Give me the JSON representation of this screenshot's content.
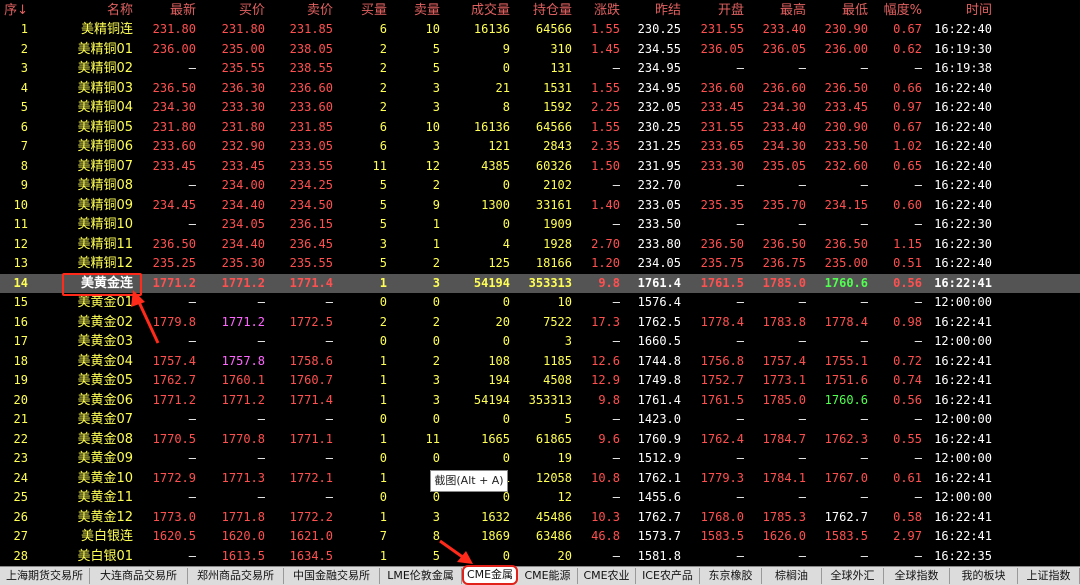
{
  "colors": {
    "header": "#e06060",
    "index": "#ffff55",
    "name": "#ffff55",
    "up": "#ff5050",
    "flat": "#ffffff",
    "down": "#50ff50",
    "volume": "#ffff55",
    "buy_purple": "#ff66ff",
    "highlight": "#ff2a1a"
  },
  "table": {
    "columns": [
      "序↓",
      "名称",
      "最新",
      "买价",
      "卖价",
      "买量",
      "卖量",
      "成交量",
      "持仓量",
      "涨跌",
      "昨结",
      "开盘",
      "最高",
      "最低",
      "幅度%",
      "时间"
    ],
    "rows": [
      [
        "1",
        "美精铜连",
        "231.80",
        "231.80",
        "231.85",
        "6",
        "10",
        "16136",
        "64566",
        "1.55",
        "230.25",
        "231.55",
        "233.40",
        "230.90",
        "0.67",
        "16:22:40"
      ],
      [
        "2",
        "美精铜01",
        "236.00",
        "235.00",
        "238.05",
        "2",
        "5",
        "9",
        "310",
        "1.45",
        "234.55",
        "236.05",
        "236.05",
        "236.00",
        "0.62",
        "16:19:30"
      ],
      [
        "3",
        "美精铜02",
        "—",
        "235.55",
        "238.55",
        "2",
        "5",
        "0",
        "131",
        "—",
        "234.95",
        "—",
        "—",
        "—",
        "—",
        "16:19:38"
      ],
      [
        "4",
        "美精铜03",
        "236.50",
        "236.30",
        "236.60",
        "2",
        "3",
        "21",
        "1531",
        "1.55",
        "234.95",
        "236.60",
        "236.60",
        "236.50",
        "0.66",
        "16:22:40"
      ],
      [
        "5",
        "美精铜04",
        "234.30",
        "233.30",
        "233.60",
        "2",
        "3",
        "8",
        "1592",
        "2.25",
        "232.05",
        "233.45",
        "234.30",
        "233.45",
        "0.97",
        "16:22:40"
      ],
      [
        "6",
        "美精铜05",
        "231.80",
        "231.80",
        "231.85",
        "6",
        "10",
        "16136",
        "64566",
        "1.55",
        "230.25",
        "231.55",
        "233.40",
        "230.90",
        "0.67",
        "16:22:40"
      ],
      [
        "7",
        "美精铜06",
        "233.60",
        "232.90",
        "233.05",
        "6",
        "3",
        "121",
        "2843",
        "2.35",
        "231.25",
        "233.65",
        "234.30",
        "233.50",
        "1.02",
        "16:22:40"
      ],
      [
        "8",
        "美精铜07",
        "233.45",
        "233.45",
        "233.55",
        "11",
        "12",
        "4385",
        "60326",
        "1.50",
        "231.95",
        "233.30",
        "235.05",
        "232.60",
        "0.65",
        "16:22:40"
      ],
      [
        "9",
        "美精铜08",
        "—",
        "234.00",
        "234.25",
        "5",
        "2",
        "0",
        "2102",
        "—",
        "232.70",
        "—",
        "—",
        "—",
        "—",
        "16:22:40"
      ],
      [
        "10",
        "美精铜09",
        "234.45",
        "234.40",
        "234.50",
        "5",
        "9",
        "1300",
        "33161",
        "1.40",
        "233.05",
        "235.35",
        "235.70",
        "234.15",
        "0.60",
        "16:22:40"
      ],
      [
        "11",
        "美精铜10",
        "—",
        "234.05",
        "236.15",
        "5",
        "1",
        "0",
        "1909",
        "—",
        "233.50",
        "—",
        "—",
        "—",
        "—",
        "16:22:30"
      ],
      [
        "12",
        "美精铜11",
        "236.50",
        "234.40",
        "236.45",
        "3",
        "1",
        "4",
        "1928",
        "2.70",
        "233.80",
        "236.50",
        "236.50",
        "236.50",
        "1.15",
        "16:22:30"
      ],
      [
        "13",
        "美精铜12",
        "235.25",
        "235.30",
        "235.55",
        "5",
        "2",
        "125",
        "18166",
        "1.20",
        "234.05",
        "235.75",
        "236.75",
        "235.00",
        "0.51",
        "16:22:40"
      ],
      [
        "14",
        "美黄金连",
        "1771.2",
        "1771.2",
        "1771.4",
        "1",
        "3",
        "54194",
        "353313",
        "9.8",
        "1761.4",
        "1761.5",
        "1785.0",
        "1760.6",
        "0.56",
        "16:22:41"
      ],
      [
        "15",
        "美黄金01",
        "—",
        "—",
        "—",
        "0",
        "0",
        "0",
        "10",
        "—",
        "1576.4",
        "—",
        "—",
        "—",
        "—",
        "12:00:00"
      ],
      [
        "16",
        "美黄金02",
        "1779.8",
        "1771.2",
        "1772.5",
        "2",
        "2",
        "20",
        "7522",
        "17.3",
        "1762.5",
        "1778.4",
        "1783.8",
        "1778.4",
        "0.98",
        "16:22:41"
      ],
      [
        "17",
        "美黄金03",
        "—",
        "—",
        "—",
        "0",
        "0",
        "0",
        "3",
        "—",
        "1660.5",
        "—",
        "—",
        "—",
        "—",
        "12:00:00"
      ],
      [
        "18",
        "美黄金04",
        "1757.4",
        "1757.8",
        "1758.6",
        "1",
        "2",
        "108",
        "1185",
        "12.6",
        "1744.8",
        "1756.8",
        "1757.4",
        "1755.1",
        "0.72",
        "16:22:41"
      ],
      [
        "19",
        "美黄金05",
        "1762.7",
        "1760.1",
        "1760.7",
        "1",
        "3",
        "194",
        "4508",
        "12.9",
        "1749.8",
        "1752.7",
        "1773.1",
        "1751.6",
        "0.74",
        "16:22:41"
      ],
      [
        "20",
        "美黄金06",
        "1771.2",
        "1771.2",
        "1771.4",
        "1",
        "3",
        "54194",
        "353313",
        "9.8",
        "1761.4",
        "1761.5",
        "1785.0",
        "1760.6",
        "0.56",
        "16:22:41"
      ],
      [
        "21",
        "美黄金07",
        "—",
        "—",
        "—",
        "0",
        "0",
        "0",
        "5",
        "—",
        "1423.0",
        "—",
        "—",
        "—",
        "—",
        "12:00:00"
      ],
      [
        "22",
        "美黄金08",
        "1770.5",
        "1770.8",
        "1771.1",
        "1",
        "11",
        "1665",
        "61865",
        "9.6",
        "1760.9",
        "1762.4",
        "1784.7",
        "1762.3",
        "0.55",
        "16:22:41"
      ],
      [
        "23",
        "美黄金09",
        "—",
        "—",
        "—",
        "0",
        "0",
        "0",
        "19",
        "—",
        "1512.9",
        "—",
        "—",
        "—",
        "—",
        "12:00:00"
      ],
      [
        "24",
        "美黄金10",
        "1772.9",
        "1771.3",
        "1772.1",
        "1",
        "4",
        "1",
        "12058",
        "10.8",
        "1762.1",
        "1779.3",
        "1784.1",
        "1767.0",
        "0.61",
        "16:22:41"
      ],
      [
        "25",
        "美黄金11",
        "—",
        "—",
        "—",
        "0",
        "0",
        "0",
        "12",
        "—",
        "1455.6",
        "—",
        "—",
        "—",
        "—",
        "12:00:00"
      ],
      [
        "26",
        "美黄金12",
        "1773.0",
        "1771.8",
        "1772.2",
        "1",
        "3",
        "1632",
        "45486",
        "10.3",
        "1762.7",
        "1768.0",
        "1785.3",
        "1762.7",
        "0.58",
        "16:22:41"
      ],
      [
        "27",
        "美白银连",
        "1620.5",
        "1620.0",
        "1621.0",
        "7",
        "8",
        "1869",
        "63486",
        "46.8",
        "1573.7",
        "1583.5",
        "1626.0",
        "1583.5",
        "2.97",
        "16:22:41"
      ],
      [
        "28",
        "美白银01",
        "—",
        "1613.5",
        "1634.5",
        "1",
        "5",
        "0",
        "20",
        "—",
        "1581.8",
        "—",
        "—",
        "—",
        "—",
        "16:22:35"
      ]
    ]
  },
  "tooltip": "截图(Alt + A)",
  "tabs": [
    "上海期货交易所",
    "大连商品交易所",
    "郑州商品交易所",
    "中国金融交易所",
    "LME伦敦金属",
    "CME金属",
    "CME能源",
    "CME农业",
    "ICE农产品",
    "东京橡胶",
    "棕榈油",
    "全球外汇",
    "全球指数",
    "我的板块",
    "上证指数"
  ],
  "active_tab": "CME金属"
}
